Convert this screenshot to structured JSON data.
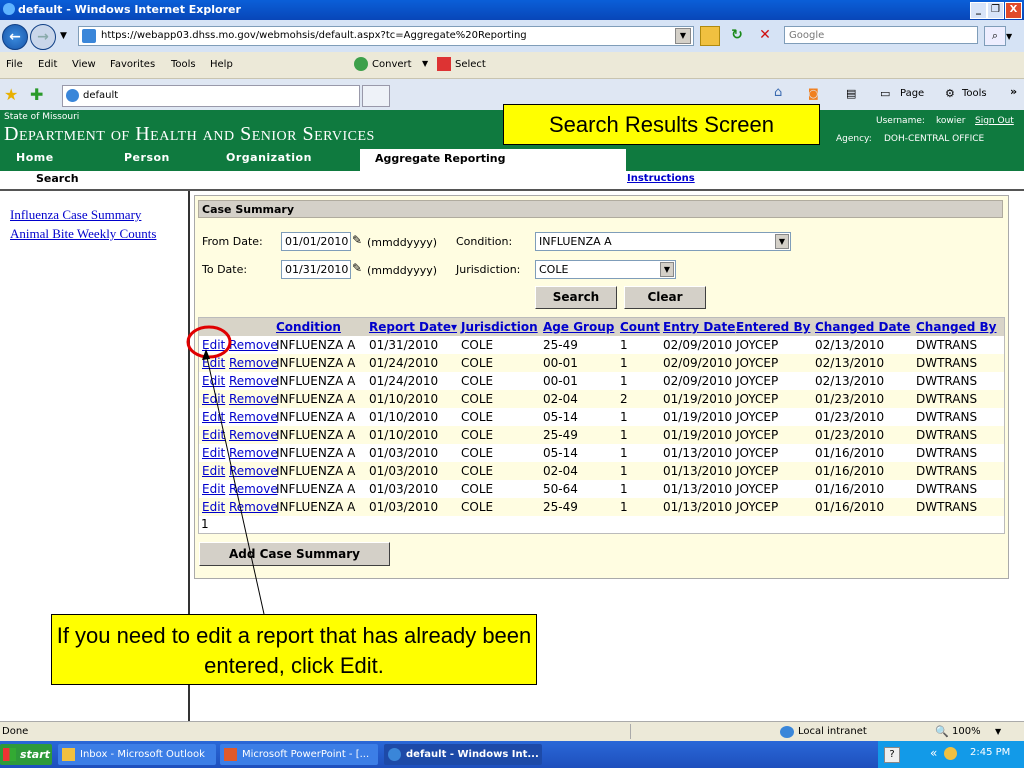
{
  "window": {
    "title": "default - Windows Internet Explorer",
    "controls": [
      "_",
      "❐",
      "X"
    ]
  },
  "browser": {
    "back_label": "←",
    "forward_label": "→",
    "address_url": "https://webapp03.dhss.mo.gov/webmohsis/default.aspx?tc=Aggregate%20Reporting",
    "search_placeholder": "Google",
    "menu": [
      "File",
      "Edit",
      "View",
      "Favorites",
      "Tools",
      "Help"
    ],
    "convert_label": "Convert",
    "select_label": "Select",
    "tab_title": "default",
    "right_tools": {
      "page": "Page",
      "tools": "Tools"
    }
  },
  "site": {
    "state": "State of Missouri",
    "department": "Department of Health and Senior Services",
    "username_label": "Username:",
    "username": "kowier",
    "sign_out": "Sign Out",
    "agency_label": "Agency:",
    "agency": "DOH-CENTRAL OFFICE",
    "nav": [
      "Home",
      "Person",
      "Organization",
      "Aggregate Reporting"
    ],
    "sub_search": "Search",
    "instructions": "Instructions"
  },
  "left_links": [
    "Influenza Case Summary",
    "Animal Bite Weekly Counts"
  ],
  "case_summary": {
    "header": "Case Summary",
    "from_date_label": "From Date:",
    "from_date": "01/01/2010",
    "to_date_label": "To Date:",
    "to_date": "01/31/2010",
    "date_hint": "(mmddyyyy)",
    "condition_label": "Condition:",
    "condition": "INFLUENZA A",
    "jurisdiction_label": "Jurisdiction:",
    "jurisdiction": "COLE",
    "search_button": "Search",
    "clear_button": "Clear",
    "add_button": "Add Case Summary",
    "page_number": "1"
  },
  "grid": {
    "headers": [
      "Condition",
      "Report Date▾",
      "Jurisdiction",
      "Age Group",
      "Count",
      "Entry Date",
      "Entered By",
      "Changed Date",
      "Changed By"
    ],
    "edit_label": "Edit",
    "remove_label": "Remove",
    "rows": [
      [
        "INFLUENZA A",
        "01/31/2010",
        "COLE",
        "25-49",
        "1",
        "02/09/2010",
        "JOYCEP",
        "02/13/2010",
        "DWTRANS"
      ],
      [
        "INFLUENZA A",
        "01/24/2010",
        "COLE",
        "00-01",
        "1",
        "02/09/2010",
        "JOYCEP",
        "02/13/2010",
        "DWTRANS"
      ],
      [
        "INFLUENZA A",
        "01/24/2010",
        "COLE",
        "00-01",
        "1",
        "02/09/2010",
        "JOYCEP",
        "02/13/2010",
        "DWTRANS"
      ],
      [
        "INFLUENZA A",
        "01/10/2010",
        "COLE",
        "02-04",
        "2",
        "01/19/2010",
        "JOYCEP",
        "01/23/2010",
        "DWTRANS"
      ],
      [
        "INFLUENZA A",
        "01/10/2010",
        "COLE",
        "05-14",
        "1",
        "01/19/2010",
        "JOYCEP",
        "01/23/2010",
        "DWTRANS"
      ],
      [
        "INFLUENZA A",
        "01/10/2010",
        "COLE",
        "25-49",
        "1",
        "01/19/2010",
        "JOYCEP",
        "01/23/2010",
        "DWTRANS"
      ],
      [
        "INFLUENZA A",
        "01/03/2010",
        "COLE",
        "05-14",
        "1",
        "01/13/2010",
        "JOYCEP",
        "01/16/2010",
        "DWTRANS"
      ],
      [
        "INFLUENZA A",
        "01/03/2010",
        "COLE",
        "02-04",
        "1",
        "01/13/2010",
        "JOYCEP",
        "01/16/2010",
        "DWTRANS"
      ],
      [
        "INFLUENZA A",
        "01/03/2010",
        "COLE",
        "50-64",
        "1",
        "01/13/2010",
        "JOYCEP",
        "01/16/2010",
        "DWTRANS"
      ],
      [
        "INFLUENZA A",
        "01/03/2010",
        "COLE",
        "25-49",
        "1",
        "01/13/2010",
        "JOYCEP",
        "01/16/2010",
        "DWTRANS"
      ]
    ]
  },
  "callouts": {
    "top": "Search Results Screen",
    "bottom": "If you need to edit a report that has already been entered, click Edit."
  },
  "status": {
    "left": "Done",
    "zone": "Local intranet",
    "zoom": "100%"
  },
  "taskbar": {
    "start": "start",
    "tasks": [
      "Inbox - Microsoft Outlook",
      "Microsoft PowerPoint - [...",
      "default - Windows Int..."
    ],
    "clock": "2:45 PM"
  },
  "colors": {
    "header_green": "#0f7a3f",
    "panel_yellow": "#fffde1",
    "callout_yellow": "#ffff00",
    "highlight_red": "#e00000"
  }
}
